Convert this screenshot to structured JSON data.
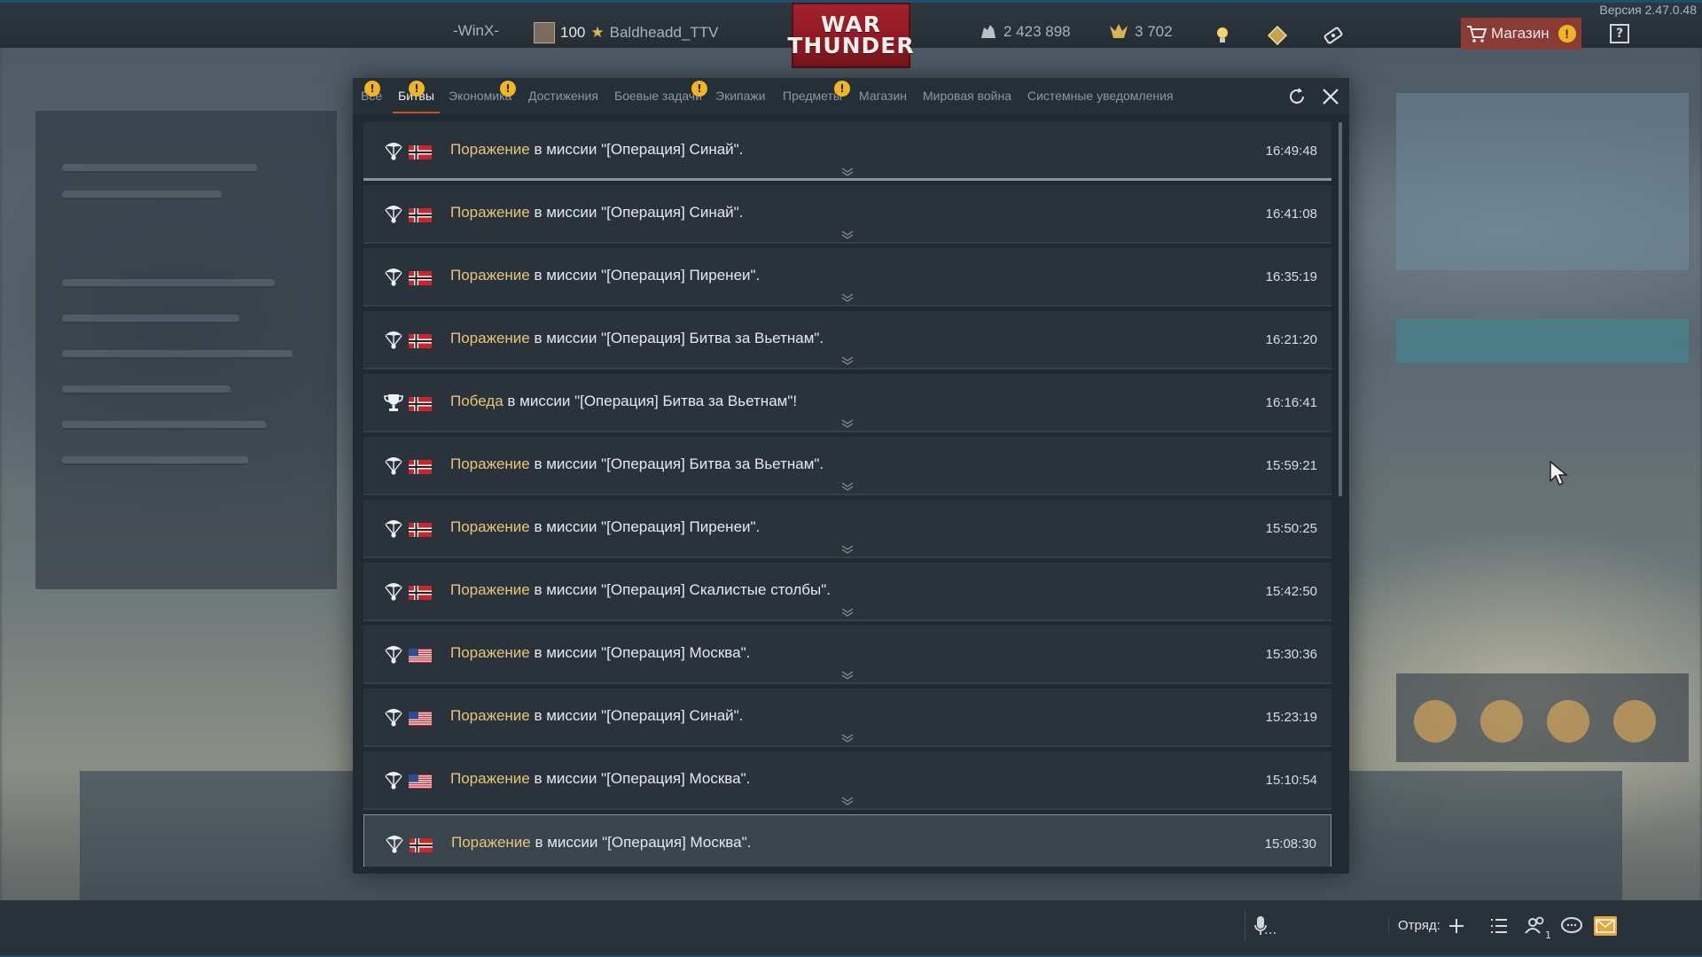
{
  "version": "Версия 2.47.0.48",
  "topbar": {
    "clan": "-WinX-",
    "player_level": "100",
    "player_name": "Baldheadd_TTV",
    "logo_line1": "WAR",
    "logo_line2": "THUNDER",
    "silver_lions": "2 423 898",
    "golden_eagles": "3 702",
    "shop_label": "Магазин",
    "shop_badge": "!",
    "help_label": "?"
  },
  "tabs": [
    {
      "label": "Все",
      "badge": "!",
      "active": false
    },
    {
      "label": "Битвы",
      "badge": "!",
      "active": true
    },
    {
      "label": "Экономика",
      "badge": "!",
      "active": false
    },
    {
      "label": "Достижения",
      "badge": "",
      "active": false
    },
    {
      "label": "Боевые задачи",
      "badge": "!",
      "active": false
    },
    {
      "label": "Экипажи",
      "badge": "",
      "active": false
    },
    {
      "label": "Предметы",
      "badge": "!",
      "active": false
    },
    {
      "label": "Магазин",
      "badge": "",
      "active": false
    },
    {
      "label": "Мировая война",
      "badge": "",
      "active": false
    },
    {
      "label": "Системные уведомления",
      "badge": "",
      "active": false
    }
  ],
  "colors": {
    "result": "#e8c47a",
    "accent": "#d24b35",
    "badge": "#f0b521",
    "flag_red": "#c9252c",
    "usa_blue": "#2f4d8f"
  },
  "notifications": [
    {
      "icon": "parachute-icon",
      "flag": "germany",
      "result": "Поражение",
      "text": " в миссии \"[Операция] Синай\".",
      "time": "16:49:48"
    },
    {
      "icon": "parachute-icon",
      "flag": "germany",
      "result": "Поражение",
      "text": " в миссии \"[Операция] Синай\".",
      "time": "16:41:08"
    },
    {
      "icon": "parachute-icon",
      "flag": "germany",
      "result": "Поражение",
      "text": " в миссии \"[Операция] Пиренеи\".",
      "time": "16:35:19"
    },
    {
      "icon": "parachute-icon",
      "flag": "germany",
      "result": "Поражение",
      "text": " в миссии \"[Операция] Битва за Вьетнам\".",
      "time": "16:21:20"
    },
    {
      "icon": "trophy-icon",
      "flag": "germany",
      "result": "Победа",
      "text": " в миссии \"[Операция] Битва за Вьетнам\"!",
      "time": "16:16:41"
    },
    {
      "icon": "parachute-icon",
      "flag": "germany",
      "result": "Поражение",
      "text": " в миссии \"[Операция] Битва за Вьетнам\".",
      "time": "15:59:21"
    },
    {
      "icon": "parachute-icon",
      "flag": "germany",
      "result": "Поражение",
      "text": " в миссии \"[Операция] Пиренеи\".",
      "time": "15:50:25"
    },
    {
      "icon": "parachute-icon",
      "flag": "germany",
      "result": "Поражение",
      "text": " в миссии \"[Операция] Скалистые столбы\".",
      "time": "15:42:50"
    },
    {
      "icon": "parachute-icon",
      "flag": "usa",
      "result": "Поражение",
      "text": " в миссии \"[Операция] Москва\".",
      "time": "15:30:36"
    },
    {
      "icon": "parachute-icon",
      "flag": "usa",
      "result": "Поражение",
      "text": " в миссии \"[Операция] Синай\".",
      "time": "15:23:19"
    },
    {
      "icon": "parachute-icon",
      "flag": "usa",
      "result": "Поражение",
      "text": " в миссии \"[Операция] Москва\".",
      "time": "15:10:54"
    },
    {
      "icon": "parachute-icon",
      "flag": "germany",
      "result": "Поражение",
      "text": " в миссии \"[Операция] Москва\".",
      "time": "15:08:30"
    }
  ],
  "bottombar": {
    "mic_text": "...",
    "squad_label": "Отряд:",
    "friends_count": "1"
  }
}
